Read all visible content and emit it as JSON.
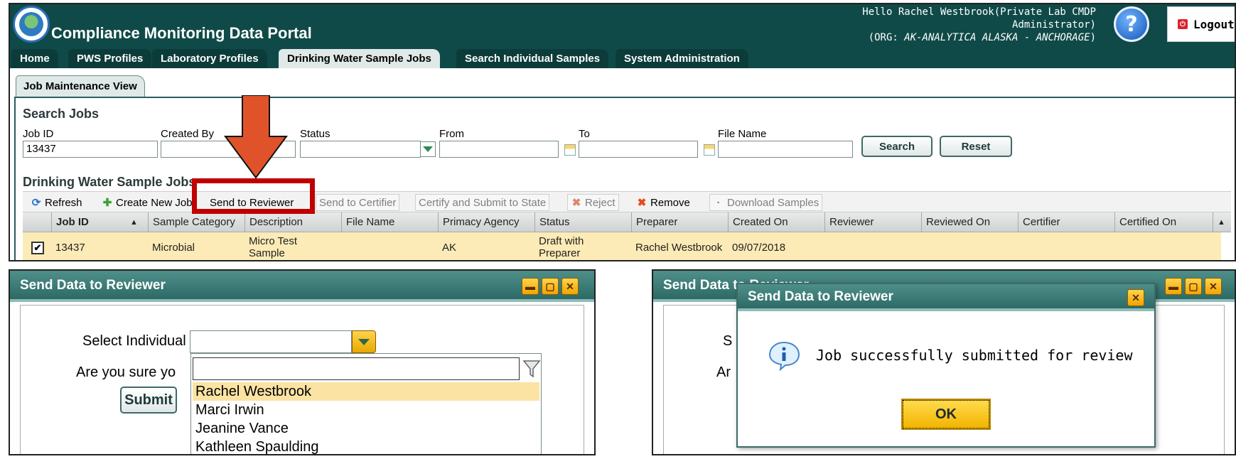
{
  "header": {
    "app_title": "Compliance Monitoring Data Portal",
    "greeting_line1": "Hello Rachel Westbrook(Private Lab CMDP",
    "greeting_line2": "Administrator)",
    "greeting_org_prefix": "(ORG: ",
    "greeting_org": "AK-ANALYTICA ALASKA - ANCHORAGE",
    "greeting_org_suffix": ")",
    "help_label": "?",
    "logout_label": "Logout"
  },
  "tabs": [
    {
      "label": "Home"
    },
    {
      "label": "PWS Profiles"
    },
    {
      "label": "Laboratory Profiles"
    },
    {
      "label": "Drinking Water Sample Jobs",
      "active": true
    },
    {
      "label": "Search Individual Samples"
    },
    {
      "label": "System Administration"
    }
  ],
  "subtab": "Job Maintenance View",
  "search": {
    "title": "Search Jobs",
    "job_id_label": "Job ID",
    "job_id_value": "13437",
    "created_by_label": "Created By",
    "status_label": "Status",
    "from_label": "From",
    "to_label": "To",
    "file_name_label": "File Name",
    "search_btn": "Search",
    "reset_btn": "Reset"
  },
  "jobs": {
    "title": "Drinking Water Sample Jobs",
    "toolbar": {
      "refresh": "Refresh",
      "create_new_job": "Create New Job",
      "send_to_reviewer": "Send to Reviewer",
      "send_to_certifier": "Send to Certifier",
      "certify_and_submit": "Certify and Submit to State",
      "reject": "Reject",
      "remove": "Remove",
      "download_samples": "Download Samples"
    },
    "columns": [
      "Job ID",
      "Sample Category",
      "Description",
      "File Name",
      "Primacy Agency",
      "Status",
      "Preparer",
      "Created On",
      "Reviewer",
      "Reviewed On",
      "Certifier",
      "Certified On"
    ],
    "row": {
      "job_id": "13437",
      "sample_category": "Microbial",
      "description_1": "Micro Test",
      "description_2": "Sample",
      "file_name": "",
      "primacy_agency": "AK",
      "status_1": "Draft with",
      "status_2": "Preparer",
      "preparer": "Rachel Westbrook",
      "created_on": "09/07/2018",
      "checked_mark": "✔"
    }
  },
  "dialog_send": {
    "title": "Send Data to Reviewer",
    "select_label": "Select Individual",
    "confirm_label": "Are you sure yo",
    "submit_btn": "Submit",
    "options": [
      "Rachel Westbrook",
      "Marci Irwin",
      "Jeanine Vance",
      "Kathleen Spaulding"
    ]
  },
  "dialog_result": {
    "bg_title": "Send Data to Reviewer",
    "bg_label1": "S",
    "bg_label2": "Ar",
    "title": "Send Data to Reviewer",
    "message": "Job successfully submitted for review",
    "ok_btn": "OK"
  },
  "annotation": {
    "arrow_color": "#e0532a",
    "box_color": "#c00000"
  }
}
